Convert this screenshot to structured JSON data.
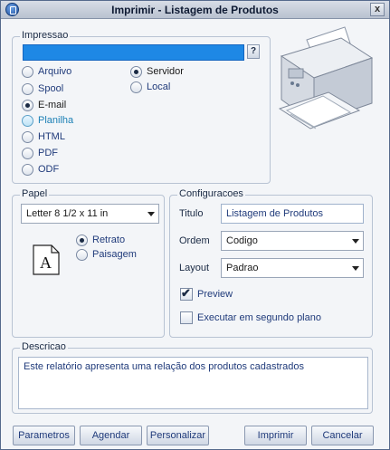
{
  "window": {
    "title": "Imprimir - Listagem de Produtos",
    "close_glyph": "x"
  },
  "impressao": {
    "label": "Impressao",
    "destination_value": "",
    "help_glyph": "?",
    "options_left": [
      {
        "label": "Arquivo",
        "checked": false
      },
      {
        "label": "Spool",
        "checked": false
      },
      {
        "label": "E-mail",
        "checked": true
      },
      {
        "label": "Planilha",
        "checked": false
      },
      {
        "label": "HTML",
        "checked": false
      },
      {
        "label": "PDF",
        "checked": false
      },
      {
        "label": "ODF",
        "checked": false
      }
    ],
    "options_right": [
      {
        "label": "Servidor",
        "checked": true
      },
      {
        "label": "Local",
        "checked": false
      }
    ]
  },
  "papel": {
    "label": "Papel",
    "size_value": "Letter 8 1/2 x 11 in",
    "orientation_icon": "document-icon",
    "orientation_letter": "A",
    "orientation": [
      {
        "label": "Retrato",
        "checked": true
      },
      {
        "label": "Paisagem",
        "checked": false
      }
    ]
  },
  "config": {
    "label": "Configuracoes",
    "titulo_label": "Titulo",
    "titulo_value": "Listagem de Produtos",
    "ordem_label": "Ordem",
    "ordem_value": "Codigo",
    "layout_label": "Layout",
    "layout_value": "Padrao",
    "preview_label": "Preview",
    "preview_checked": true,
    "background_label": "Executar em segundo plano",
    "background_checked": false
  },
  "descricao": {
    "label": "Descricao",
    "text": "Este relatório apresenta uma relação dos produtos cadastrados"
  },
  "buttons": {
    "parametros": "Parametros",
    "agendar": "Agendar",
    "personalizar": "Personalizar",
    "imprimir": "Imprimir",
    "cancelar": "Cancelar"
  }
}
